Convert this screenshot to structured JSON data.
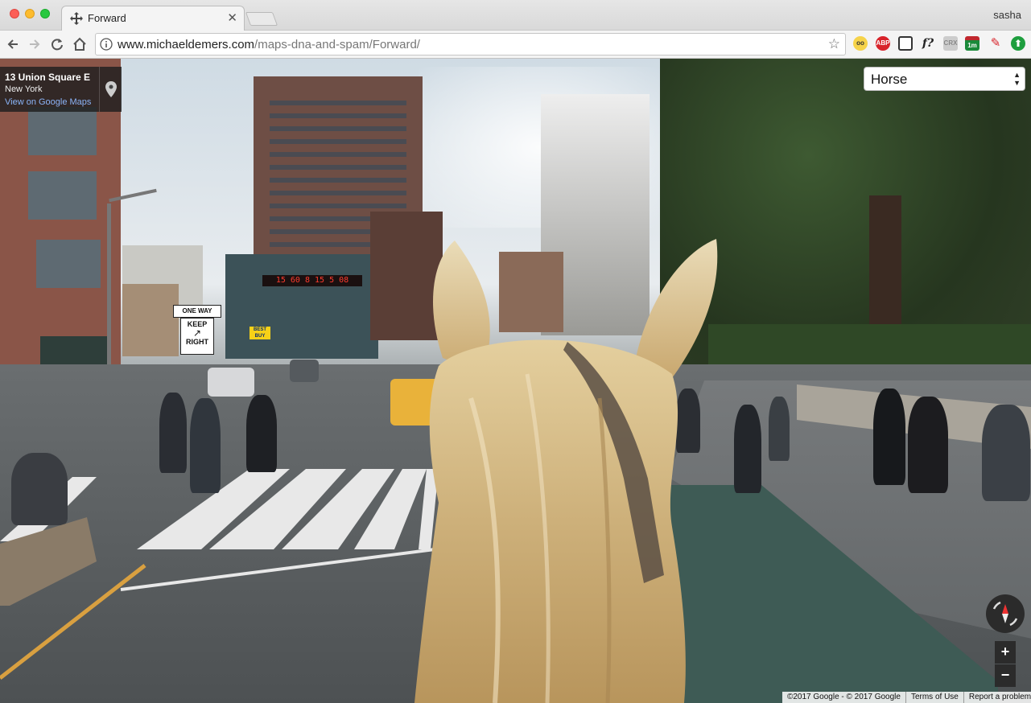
{
  "browser": {
    "tab_title": "Forward",
    "profile_name": "sasha",
    "url_host": "www.michaeldemers.com",
    "url_path": "/maps-dna-and-spam/Forward/",
    "extensions": [
      "glasses-icon",
      "abp-icon",
      "reader-icon",
      "font-icon",
      "crx-icon",
      "calendar-icon",
      "pen-icon",
      "upload-icon"
    ],
    "ext_labels": {
      "abp": "ABP",
      "font": "f?",
      "crx": "CRX",
      "calendar": "1m"
    }
  },
  "place_card": {
    "name": "13 Union Square E",
    "city": "New York",
    "link": "View on Google Maps"
  },
  "mode_select": {
    "value": "Horse"
  },
  "scene": {
    "clock_digits": "15 60 8 15 5 08",
    "sign_one_way": "ONE WAY",
    "sign_keep": "KEEP",
    "sign_right": "RIGHT",
    "sign_store": "BEST BUY"
  },
  "map_controls": {
    "zoom_in": "+",
    "zoom_out": "−"
  },
  "footer": {
    "copyright": "©2017 Google - © 2017 Google",
    "terms": "Terms of Use",
    "report": "Report a problem"
  }
}
